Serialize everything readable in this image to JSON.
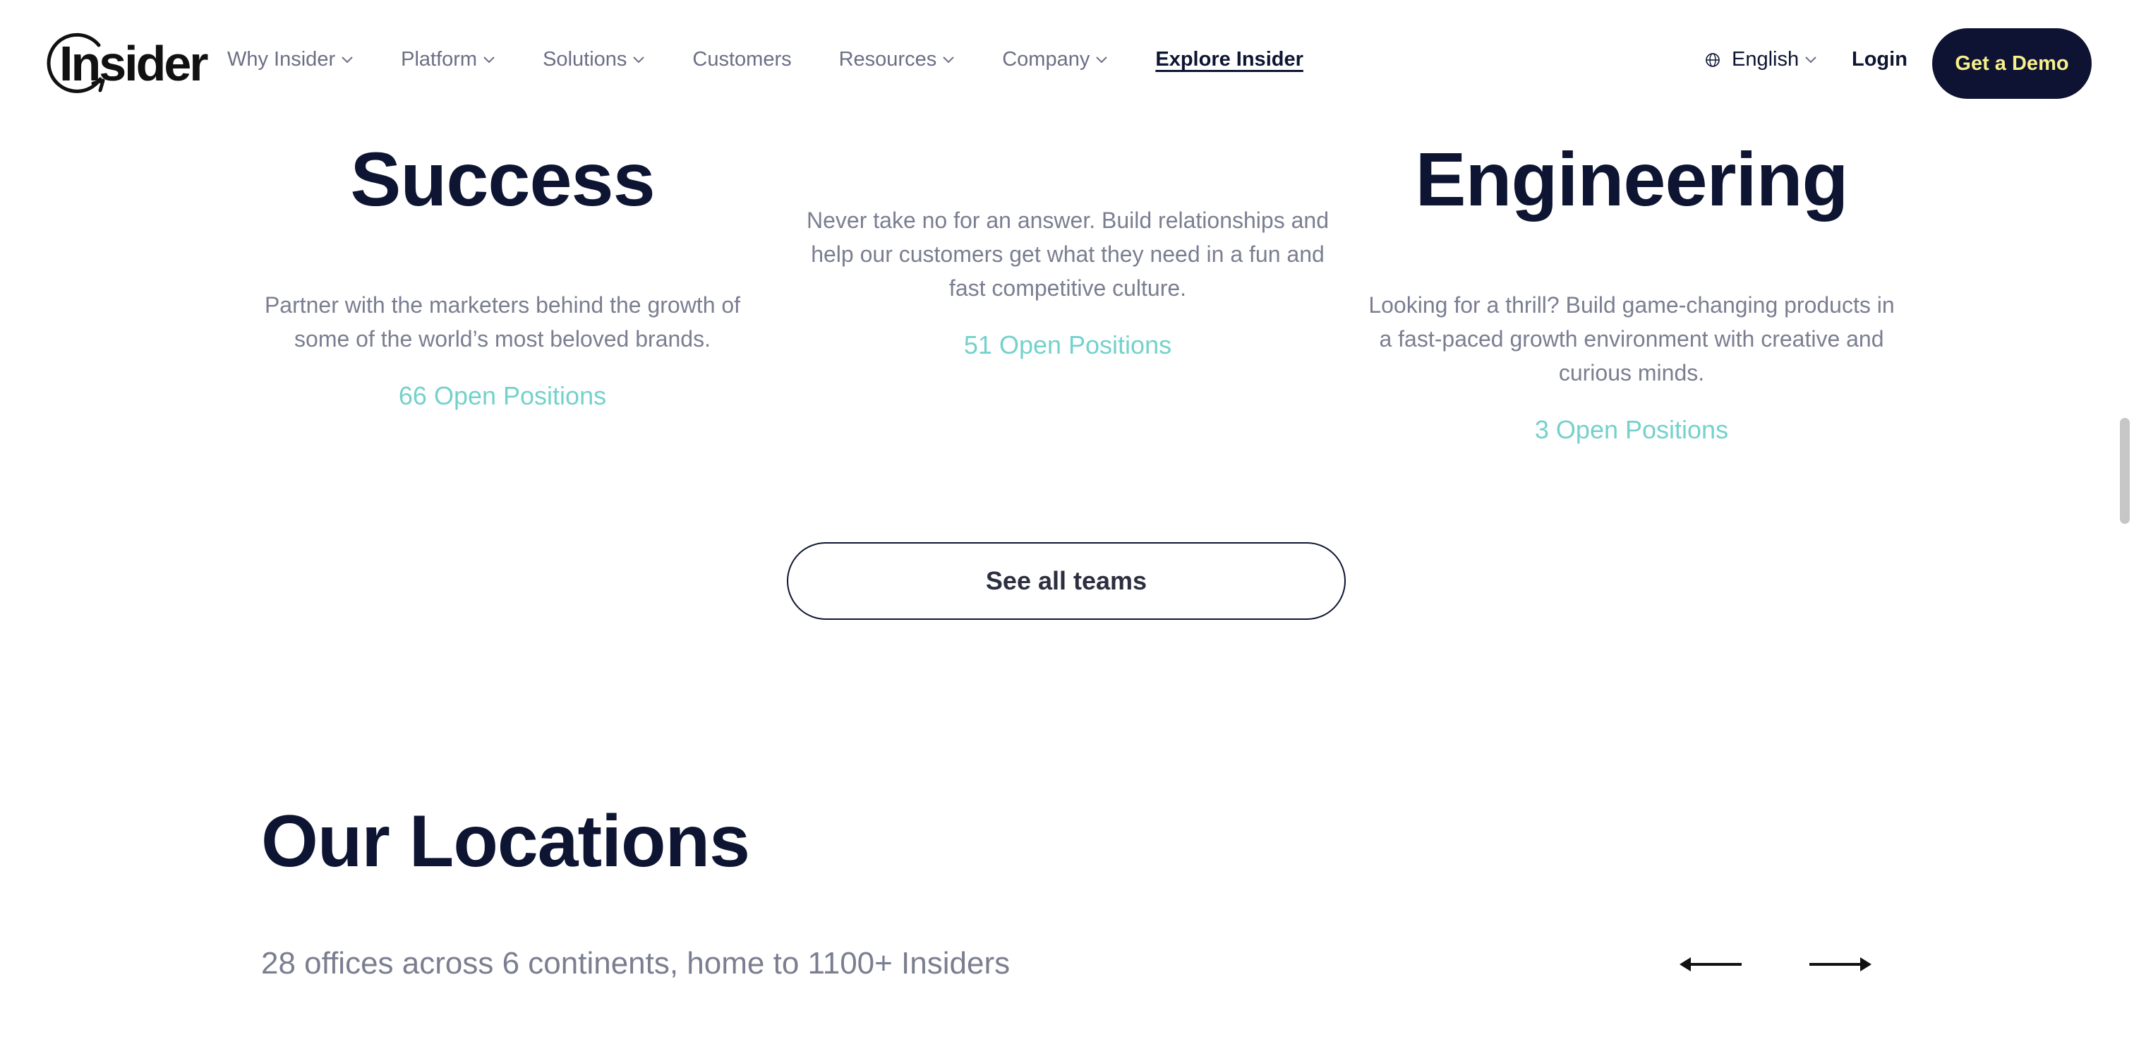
{
  "nav": {
    "logo_text": "Insider",
    "items": [
      {
        "label": "Why Insider",
        "dropdown": true
      },
      {
        "label": "Platform",
        "dropdown": true
      },
      {
        "label": "Solutions",
        "dropdown": true
      },
      {
        "label": "Customers",
        "dropdown": false
      },
      {
        "label": "Resources",
        "dropdown": true
      },
      {
        "label": "Company",
        "dropdown": true
      }
    ],
    "explore_label": "Explore Insider",
    "language": "English",
    "login_label": "Login",
    "demo_label": "Get a Demo"
  },
  "teams": [
    {
      "title": "Success",
      "description": "Partner with the marketers behind the growth of some of the world’s most beloved brands.",
      "positions": "66 Open Positions"
    },
    {
      "title": "",
      "description": "Never take no for an answer. Build relationships and help our customers get what they need in a fun and fast competitive culture.",
      "positions": "51 Open Positions"
    },
    {
      "title": "Engineering",
      "description": "Looking for a thrill? Build game-changing products in a fast-paced growth environment with creative and curious minds.",
      "positions": "3 Open Positions"
    }
  ],
  "see_all_label": "See all teams",
  "locations": {
    "title": "Our Locations",
    "subtitle": "28 offices across 6 continents, home to 1100+ Insiders"
  },
  "colors": {
    "navy": "#0e1532",
    "demo_text": "#f6f08a",
    "teal": "#74d1cc",
    "muted": "#7a7e90"
  }
}
